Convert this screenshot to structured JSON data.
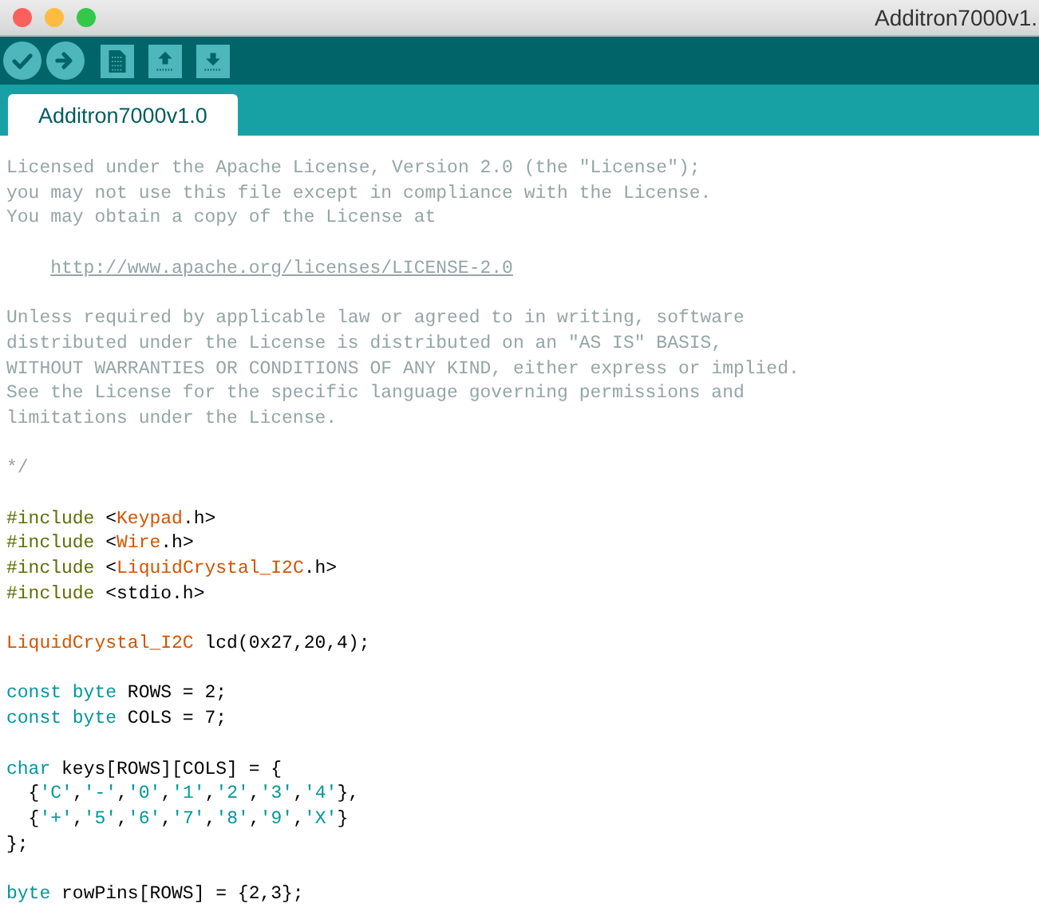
{
  "window": {
    "title": "Additron7000v1."
  },
  "toolbar": [
    {
      "kind": "verify"
    },
    {
      "kind": "upload"
    },
    {
      "kind": "new"
    },
    {
      "kind": "open"
    },
    {
      "kind": "save"
    }
  ],
  "tabs": [
    {
      "label": "Additron7000v1.0",
      "selected": true
    }
  ],
  "editor": {
    "lines": [
      {
        "kind": "code",
        "tokens": [
          {
            "text": "Licensed under the Apache License, Version 2.0 (the \"License\");",
            "kind": "comment"
          }
        ]
      },
      {
        "kind": "code",
        "tokens": [
          {
            "text": "you may not use this file except in compliance with the License.",
            "kind": "comment"
          }
        ]
      },
      {
        "kind": "code",
        "tokens": [
          {
            "text": "You may obtain a copy of the License at",
            "kind": "comment"
          }
        ]
      },
      {
        "kind": "blank"
      },
      {
        "kind": "indented",
        "tokens": [
          {
            "text": "http://www.apache.org/licenses/LICENSE-2.0",
            "kind": "link"
          }
        ]
      },
      {
        "kind": "blank"
      },
      {
        "kind": "code",
        "tokens": [
          {
            "text": "Unless required by applicable law or agreed to in writing, software",
            "kind": "comment"
          }
        ]
      },
      {
        "kind": "code",
        "tokens": [
          {
            "text": "distributed under the License is distributed on an \"AS IS\" BASIS,",
            "kind": "comment"
          }
        ]
      },
      {
        "kind": "code",
        "tokens": [
          {
            "text": "WITHOUT WARRANTIES OR CONDITIONS OF ANY KIND, either express or implied.",
            "kind": "comment"
          }
        ]
      },
      {
        "kind": "code",
        "tokens": [
          {
            "text": "See the License for the specific language governing permissions and",
            "kind": "comment"
          }
        ]
      },
      {
        "kind": "code",
        "tokens": [
          {
            "text": "limitations under the License.",
            "kind": "comment"
          }
        ]
      },
      {
        "kind": "blank"
      },
      {
        "kind": "code",
        "tokens": [
          {
            "text": "*/",
            "kind": "comment"
          }
        ]
      },
      {
        "kind": "blank"
      },
      {
        "kind": "code",
        "tokens": [
          {
            "text": "#include",
            "kind": "directive"
          },
          {
            "text": " <",
            "kind": "plain"
          },
          {
            "text": "Keypad",
            "kind": "library"
          },
          {
            "text": ".h>",
            "kind": "plain"
          }
        ]
      },
      {
        "kind": "code",
        "tokens": [
          {
            "text": "#include",
            "kind": "directive"
          },
          {
            "text": " <",
            "kind": "plain"
          },
          {
            "text": "Wire",
            "kind": "library"
          },
          {
            "text": ".h>",
            "kind": "plain"
          }
        ]
      },
      {
        "kind": "code",
        "tokens": [
          {
            "text": "#include",
            "kind": "directive"
          },
          {
            "text": " <",
            "kind": "plain"
          },
          {
            "text": "LiquidCrystal_I2C",
            "kind": "library"
          },
          {
            "text": ".h>",
            "kind": "plain"
          }
        ]
      },
      {
        "kind": "code",
        "tokens": [
          {
            "text": "#include",
            "kind": "directive"
          },
          {
            "text": " <stdio.h>",
            "kind": "plain"
          }
        ]
      },
      {
        "kind": "blank"
      },
      {
        "kind": "code",
        "tokens": [
          {
            "text": "LiquidCrystal_I2C",
            "kind": "library"
          },
          {
            "text": " lcd(0x27,20,4);",
            "kind": "plain"
          }
        ]
      },
      {
        "kind": "blank"
      },
      {
        "kind": "code",
        "tokens": [
          {
            "text": "const byte",
            "kind": "keyword"
          },
          {
            "text": " ROWS = 2;",
            "kind": "plain"
          }
        ]
      },
      {
        "kind": "code",
        "tokens": [
          {
            "text": "const byte",
            "kind": "keyword"
          },
          {
            "text": " COLS = 7;",
            "kind": "plain"
          }
        ]
      },
      {
        "kind": "blank"
      },
      {
        "kind": "code",
        "tokens": [
          {
            "text": "char",
            "kind": "keyword"
          },
          {
            "text": " keys[ROWS][COLS] = {",
            "kind": "plain"
          }
        ]
      },
      {
        "kind": "code",
        "tokens": [
          {
            "text": "  {",
            "kind": "plain"
          },
          {
            "text": "'C'",
            "kind": "string"
          },
          {
            "text": ",",
            "kind": "plain"
          },
          {
            "text": "'-'",
            "kind": "string"
          },
          {
            "text": ",",
            "kind": "plain"
          },
          {
            "text": "'0'",
            "kind": "string"
          },
          {
            "text": ",",
            "kind": "plain"
          },
          {
            "text": "'1'",
            "kind": "string"
          },
          {
            "text": ",",
            "kind": "plain"
          },
          {
            "text": "'2'",
            "kind": "string"
          },
          {
            "text": ",",
            "kind": "plain"
          },
          {
            "text": "'3'",
            "kind": "string"
          },
          {
            "text": ",",
            "kind": "plain"
          },
          {
            "text": "'4'",
            "kind": "string"
          },
          {
            "text": "},",
            "kind": "plain"
          }
        ]
      },
      {
        "kind": "code",
        "tokens": [
          {
            "text": "  {",
            "kind": "plain"
          },
          {
            "text": "'+'",
            "kind": "string"
          },
          {
            "text": ",",
            "kind": "plain"
          },
          {
            "text": "'5'",
            "kind": "string"
          },
          {
            "text": ",",
            "kind": "plain"
          },
          {
            "text": "'6'",
            "kind": "string"
          },
          {
            "text": ",",
            "kind": "plain"
          },
          {
            "text": "'7'",
            "kind": "string"
          },
          {
            "text": ",",
            "kind": "plain"
          },
          {
            "text": "'8'",
            "kind": "string"
          },
          {
            "text": ",",
            "kind": "plain"
          },
          {
            "text": "'9'",
            "kind": "string"
          },
          {
            "text": ",",
            "kind": "plain"
          },
          {
            "text": "'X'",
            "kind": "string"
          },
          {
            "text": "}",
            "kind": "plain"
          }
        ]
      },
      {
        "kind": "code",
        "tokens": [
          {
            "text": "};",
            "kind": "plain"
          }
        ]
      },
      {
        "kind": "blank"
      },
      {
        "kind": "code",
        "tokens": [
          {
            "text": "byte",
            "kind": "keyword"
          },
          {
            "text": " rowPins[ROWS] = {2,3};",
            "kind": "plain"
          }
        ]
      }
    ]
  }
}
